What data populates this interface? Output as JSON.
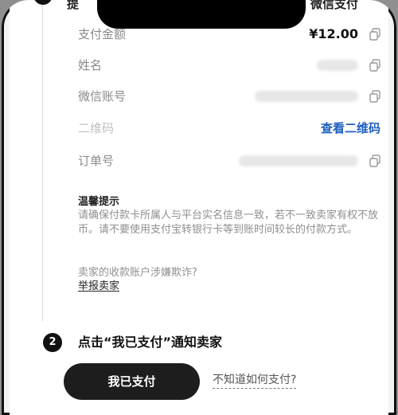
{
  "step1": {
    "partial_left": "提",
    "partial_right": "微信支付"
  },
  "rows": {
    "amount": {
      "label": "支付金额",
      "value": "¥12.00"
    },
    "name": {
      "label": "姓名"
    },
    "wechat": {
      "label": "微信账号"
    },
    "qrcode": {
      "label": "二维码",
      "link": "查看二维码"
    },
    "order": {
      "label": "订单号"
    }
  },
  "tips": {
    "title": "温馨提示",
    "body": "请确保付款卡所属人与平台实名信息一致，若不一致卖家有权不放币。请不要使用支付宝转银行卡等到账时间较长的付款方式。",
    "question": "卖家的收款账户涉嫌欺诈?",
    "report_link": "举报卖家"
  },
  "step2": {
    "number": "2",
    "title": "点击“我已支付”通知卖家",
    "paid_button": "我已支付",
    "howto_link": "不知道如何支付?"
  },
  "icons": {
    "copy": "copy-icon"
  },
  "colors": {
    "link_blue": "#1f5fbf",
    "button_dark": "#1d1d1d"
  }
}
